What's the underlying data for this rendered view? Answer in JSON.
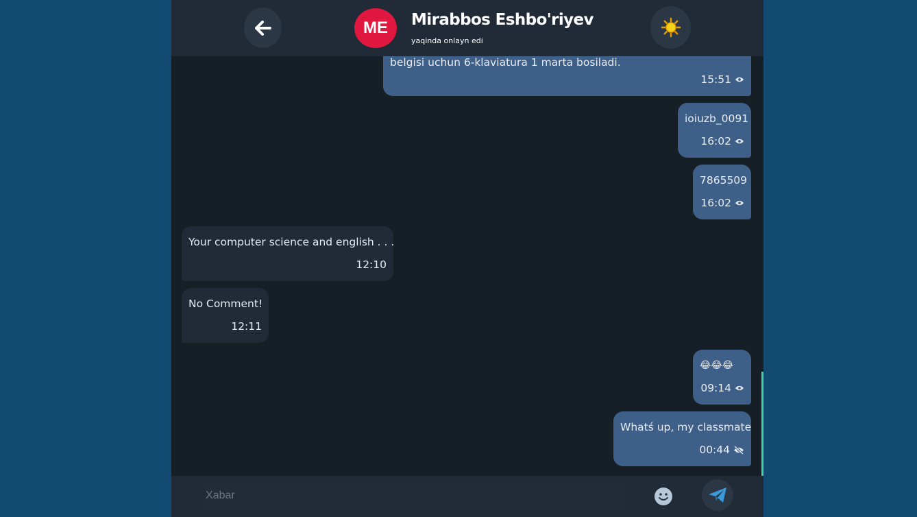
{
  "header": {
    "avatar_initials": "ME",
    "avatar_color": "#e0173f",
    "contact_name": "Mirabbos Eshbo'riyev",
    "status": "yaqinda onlayn edi",
    "back_icon": "arrow-left-icon",
    "theme_icon": "sun-icon"
  },
  "messages": [
    {
      "direction": "out",
      "text": "belgisi uchun 6-klaviatura 1 marta bosiladi.",
      "time": "15:51",
      "seen": true
    },
    {
      "direction": "out",
      "text": "ioiuzb_0091",
      "time": "16:02",
      "seen": true
    },
    {
      "direction": "out",
      "text": "7865509",
      "time": "16:02",
      "seen": true
    },
    {
      "direction": "in",
      "text": "Your computer science and english . . .",
      "time": "12:10"
    },
    {
      "direction": "in",
      "text": "No Comment!",
      "time": "12:11"
    },
    {
      "direction": "out",
      "text": "😂😂😂",
      "time": "09:14",
      "seen": true
    },
    {
      "direction": "out",
      "text": "Whatś up, my classmate",
      "time": "00:44",
      "seen": false
    }
  ],
  "composer": {
    "placeholder": "Xabar",
    "emoji_icon": "smiley-icon",
    "send_icon": "send-icon"
  },
  "colors": {
    "page_background": "#134a72",
    "chat_background": "#161e26",
    "outgoing_bubble": "#3e5f88",
    "incoming_bubble": "#212b37",
    "accent": "#40d3a9"
  }
}
